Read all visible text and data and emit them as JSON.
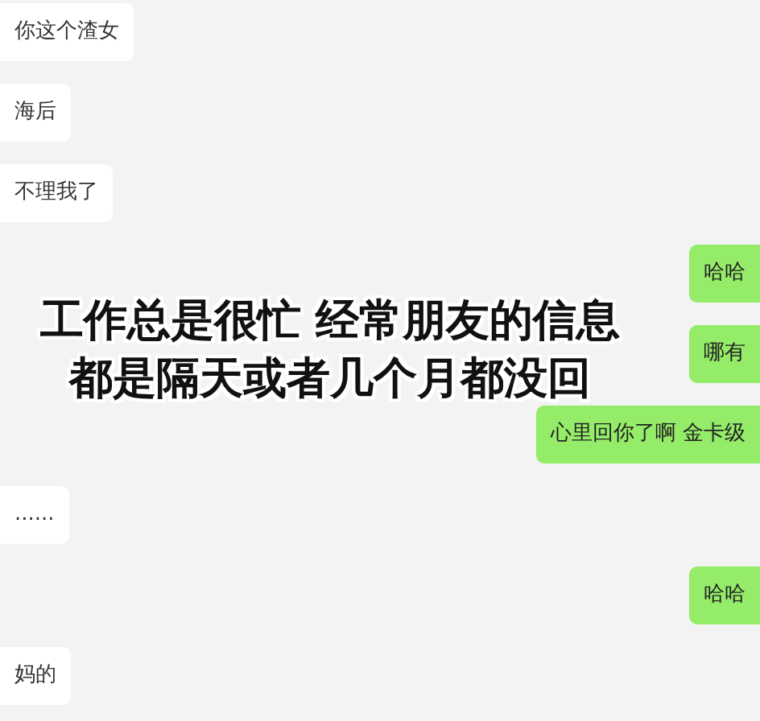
{
  "messages": [
    {
      "kind": "received",
      "text": "你这个渣女"
    },
    {
      "kind": "received",
      "text": "海后"
    },
    {
      "kind": "received",
      "text": "不理我了"
    },
    {
      "kind": "sent",
      "text": "哈哈"
    },
    {
      "kind": "sent",
      "text": "哪有"
    },
    {
      "kind": "sent",
      "text": "心里回你了啊 金卡级"
    },
    {
      "kind": "received",
      "text": "......"
    },
    {
      "kind": "sent",
      "text": "哈哈"
    },
    {
      "kind": "received",
      "text": "妈的"
    }
  ],
  "caption": {
    "lines": [
      "工作总是很忙 经常朋友的信息",
      "都是隔天或者几个月都没回"
    ]
  }
}
